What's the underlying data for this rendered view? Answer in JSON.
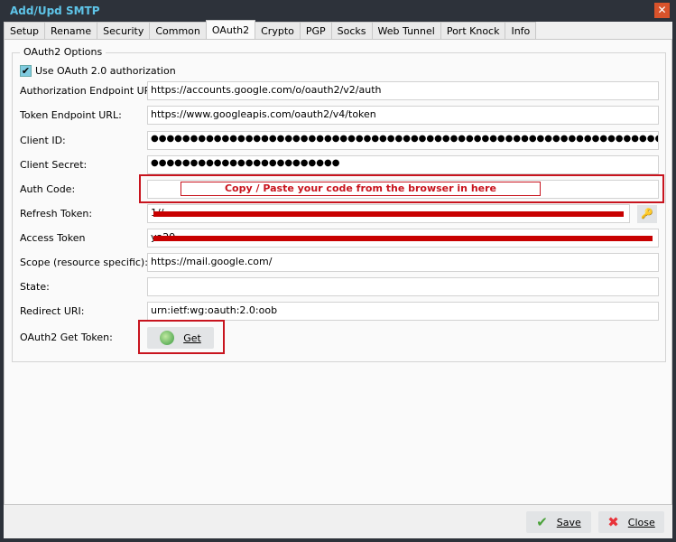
{
  "window": {
    "title": "Add/Upd SMTP",
    "close_icon": "close-icon"
  },
  "tabs": [
    {
      "label": "Setup"
    },
    {
      "label": "Rename"
    },
    {
      "label": "Security"
    },
    {
      "label": "Common"
    },
    {
      "label": "OAuth2",
      "active": true
    },
    {
      "label": "Crypto"
    },
    {
      "label": "PGP"
    },
    {
      "label": "Socks"
    },
    {
      "label": "Web Tunnel"
    },
    {
      "label": "Port Knock"
    },
    {
      "label": "Info"
    }
  ],
  "group": {
    "title": "OAuth2 Options"
  },
  "use_oauth": {
    "label": "Use OAuth 2.0 authorization",
    "checked": true
  },
  "fields": {
    "auth_endpoint": {
      "label": "Authorization Endpoint URL:",
      "value": "https://accounts.google.com/o/oauth2/v2/auth"
    },
    "token_endpoint": {
      "label": "Token Endpoint URL:",
      "value": "https://www.googleapis.com/oauth2/v4/token"
    },
    "client_id": {
      "label": "Client ID:",
      "value": "●●●●●●●●●●●●●●●●●●●●●●●●●●●●●●●●●●●●●●●●●●●●●●●●●●●●●●●●●●●●●●●●●●●●●●●●"
    },
    "client_secret": {
      "label": "Client Secret:",
      "value": "●●●●●●●●●●●●●●●●●●●●●●●●"
    },
    "auth_code": {
      "label": "Auth Code:",
      "value": "",
      "hint": "Copy / Paste your code from the browser in here"
    },
    "refresh_token": {
      "label": "Refresh Token:",
      "value": "1//"
    },
    "access_token": {
      "label": "Access Token",
      "value": "ya29"
    },
    "scope": {
      "label": "Scope (resource specific):",
      "value": "https://mail.google.com/"
    },
    "state": {
      "label": "State:",
      "value": ""
    },
    "redirect_uri": {
      "label": "Redirect URI:",
      "value": "urn:ietf:wg:oauth:2.0:oob"
    },
    "get_token": {
      "label": "OAuth2 Get Token:",
      "button": "Get"
    }
  },
  "footer": {
    "save": "Save",
    "close": "Close"
  },
  "colors": {
    "accent": "#5ec4e8",
    "highlight": "#c8141e",
    "redaction": "#c80000"
  }
}
